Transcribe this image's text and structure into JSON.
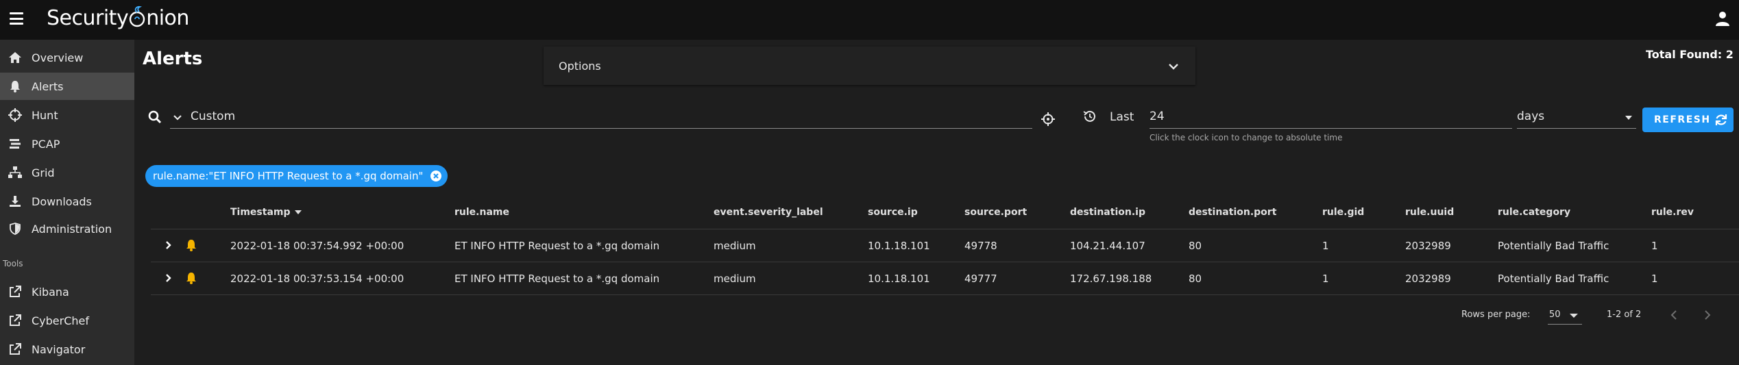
{
  "app": {
    "logo_text_left": "Security",
    "logo_text_right": "nion"
  },
  "sidebar": {
    "items": [
      {
        "label": "Overview",
        "icon": "home-icon"
      },
      {
        "label": "Alerts",
        "icon": "bell-icon",
        "active": true
      },
      {
        "label": "Hunt",
        "icon": "crosshairs-icon"
      },
      {
        "label": "PCAP",
        "icon": "stream-icon"
      },
      {
        "label": "Grid",
        "icon": "sitemap-icon"
      },
      {
        "label": "Downloads",
        "icon": "download-icon"
      },
      {
        "label": "Administration",
        "icon": "shield-icon"
      }
    ],
    "tools_label": "Tools",
    "tools": [
      {
        "label": "Kibana",
        "icon": "external-link-icon"
      },
      {
        "label": "CyberChef",
        "icon": "external-link-icon"
      },
      {
        "label": "Navigator",
        "icon": "external-link-icon"
      }
    ]
  },
  "main": {
    "title": "Alerts",
    "options_label": "Options",
    "total_found": "Total Found: 2"
  },
  "search": {
    "query": "Custom",
    "last_label": "Last",
    "last_value": "24",
    "unit": "days",
    "hint": "Click the clock icon to change to absolute time",
    "refresh_label": "REFRESH"
  },
  "filter_chip": {
    "label": "rule.name:\"ET INFO HTTP Request to a *.gq domain\""
  },
  "table": {
    "headers": [
      "Timestamp",
      "rule.name",
      "event.severity_label",
      "source.ip",
      "source.port",
      "destination.ip",
      "destination.port",
      "rule.gid",
      "rule.uuid",
      "rule.category",
      "rule.rev"
    ],
    "rows": [
      [
        "2022-01-18 00:37:54.992 +00:00",
        "ET INFO HTTP Request to a *.gq domain",
        "medium",
        "10.1.18.101",
        "49778",
        "104.21.44.107",
        "80",
        "1",
        "2032989",
        "Potentially Bad Traffic",
        "1"
      ],
      [
        "2022-01-18 00:37:53.154 +00:00",
        "ET INFO HTTP Request to a *.gq domain",
        "medium",
        "10.1.18.101",
        "49777",
        "172.67.198.188",
        "80",
        "1",
        "2032989",
        "Potentially Bad Traffic",
        "1"
      ]
    ]
  },
  "pagination": {
    "rows_per_page_label": "Rows per page:",
    "rows_per_page": "50",
    "range": "1-2 of 2"
  },
  "colors": {
    "accent": "#2196f3",
    "bell": "#f5b400",
    "active_nav": "#4a4a4a"
  }
}
